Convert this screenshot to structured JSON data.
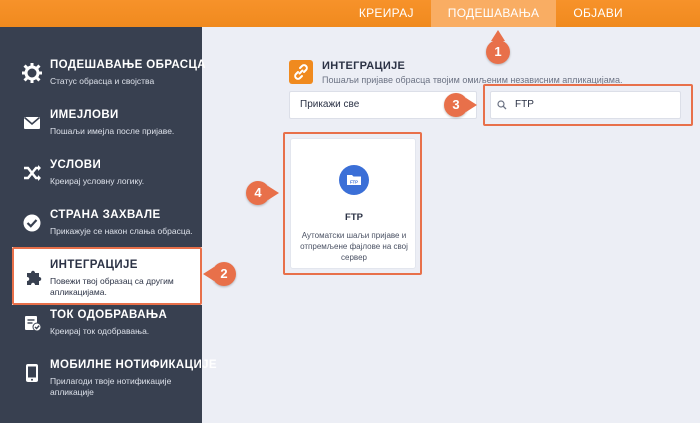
{
  "top_tabs": [
    {
      "label": "КРЕИРАЈ"
    },
    {
      "label": "ПОДЕШАВАЊА"
    },
    {
      "label": "ОБЈАВИ"
    }
  ],
  "sidebar": {
    "items": [
      {
        "title": "ПОДЕШАВАЊЕ ОБРАСЦА",
        "desc": "Статус обрасца и својства",
        "icon": "gear-icon"
      },
      {
        "title": "ИМЕЈЛОВИ",
        "desc": "Пошаљи имејла после пријаве.",
        "icon": "envelope-icon"
      },
      {
        "title": "УСЛОВИ",
        "desc": "Креирај условну логику.",
        "icon": "shuffle-icon"
      },
      {
        "title": "СТРАНА ЗАХВАЛЕ",
        "desc": "Прикажује се након слања обрасца.",
        "icon": "check-circle-icon"
      },
      {
        "title": "ИНТЕГРАЦИЈЕ",
        "desc": "Повежи твој образац са другим апликацијама.",
        "icon": "puzzle-icon"
      },
      {
        "title": "ТОК ОДОБРАВАЊА",
        "desc": "Креирај ток одобравања.",
        "icon": "approval-icon"
      },
      {
        "title": "МОБИЛНЕ НОТИФИКАЦИЈЕ",
        "desc": "Прилагоди твоје нотификације апликације",
        "icon": "mobile-icon"
      }
    ]
  },
  "main": {
    "title": "ИНТЕГРАЦИЈЕ",
    "subtitle": "Пошаљи пријаве обрасца твојим омиљеним независним апликацијама.",
    "filter_value": "Прикажи све",
    "search_value": "FTP",
    "card": {
      "name": "FTP",
      "logo_text": "FTP",
      "description": "Аутоматски шаљи пријаве и отпремљене фајлове на свој сервер"
    }
  },
  "markers": [
    "1",
    "2",
    "3",
    "4"
  ],
  "colors": {
    "accent": "#f08a1e",
    "marker": "#e8704a",
    "sidebar": "#384050",
    "ftp_blue": "#3b6fd7"
  }
}
